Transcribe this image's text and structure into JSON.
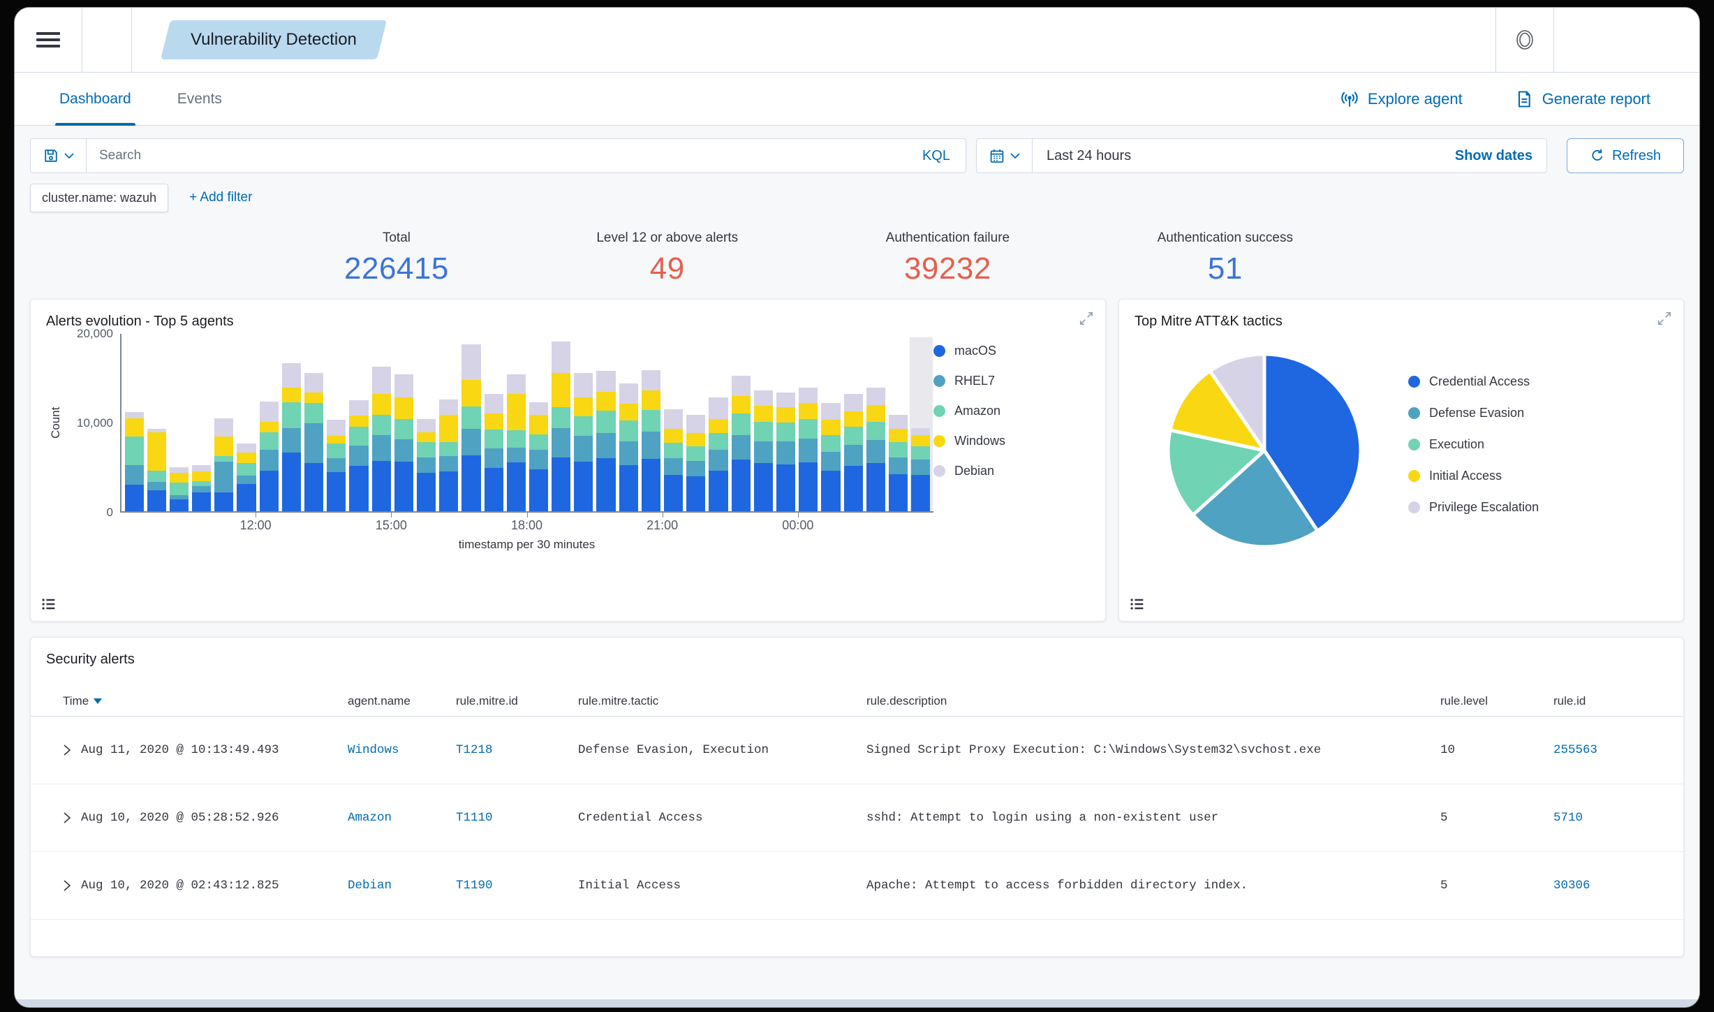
{
  "header": {
    "breadcrumb": "Vulnerability Detection"
  },
  "tabs": [
    {
      "label": "Dashboard",
      "active": true
    },
    {
      "label": "Events",
      "active": false
    }
  ],
  "actions": {
    "explore_agent": "Explore agent",
    "generate_report": "Generate report"
  },
  "search": {
    "placeholder": "Search",
    "language": "KQL"
  },
  "datepicker": {
    "value": "Last 24 hours",
    "show_dates": "Show dates",
    "refresh": "Refresh"
  },
  "filters": {
    "pills": [
      "cluster.name: wazuh"
    ],
    "add_filter": "+ Add filter"
  },
  "stats": [
    {
      "label": "Total",
      "value": "226415",
      "color": "#3b73d8"
    },
    {
      "label": "Level 12 or above alerts",
      "value": "49",
      "color": "#e4604e"
    },
    {
      "label": "Authentication failure",
      "value": "39232",
      "color": "#e4604e"
    },
    {
      "label": "Authentication success",
      "value": "51",
      "color": "#3b73d8"
    }
  ],
  "chart_data": [
    {
      "type": "bar",
      "stacked": true,
      "title": "Alerts evolution - Top 5 agents",
      "xlabel": "timestamp per 30 minutes",
      "ylabel": "Count",
      "ylim": [
        0,
        20000
      ],
      "yticks": [
        {
          "label": "0",
          "frac": 0
        },
        {
          "label": "10,000",
          "frac": 0.5
        },
        {
          "label": "20,000",
          "frac": 1
        }
      ],
      "xticks": [
        {
          "label": "12:00",
          "boundary": 6
        },
        {
          "label": "15:00",
          "boundary": 12
        },
        {
          "label": "18:00",
          "boundary": 18
        },
        {
          "label": "21:00",
          "boundary": 24
        },
        {
          "label": "00:00",
          "boundary": 30
        }
      ],
      "n_bars": 36,
      "series": [
        {
          "name": "macOS",
          "color": "#1f67e0"
        },
        {
          "name": "RHEL7",
          "color": "#4fa2c2"
        },
        {
          "name": "Amazon",
          "color": "#6fd3b4"
        },
        {
          "name": "Windows",
          "color": "#f9d713"
        },
        {
          "name": "Debian",
          "color": "#d6d3e6"
        }
      ],
      "bars": [
        [
          3000,
          2200,
          3200,
          2100,
          700
        ],
        [
          2400,
          900,
          1300,
          4300,
          400
        ],
        [
          1300,
          500,
          1400,
          1100,
          700
        ],
        [
          2100,
          700,
          600,
          1100,
          700
        ],
        [
          2100,
          3500,
          600,
          2200,
          2100
        ],
        [
          3100,
          900,
          1400,
          1200,
          1000
        ],
        [
          4600,
          2300,
          2000,
          1200,
          2300
        ],
        [
          6600,
          2800,
          2900,
          1600,
          2800
        ],
        [
          5400,
          4500,
          2300,
          1200,
          2200
        ],
        [
          4400,
          1600,
          1600,
          900,
          1800
        ],
        [
          5100,
          2300,
          2100,
          1300,
          1700
        ],
        [
          5700,
          2900,
          2300,
          2300,
          3100
        ],
        [
          5600,
          2500,
          2300,
          2400,
          2600
        ],
        [
          4300,
          1800,
          1700,
          1100,
          1500
        ],
        [
          4500,
          1700,
          1600,
          3100,
          1700
        ],
        [
          6300,
          3000,
          2500,
          3000,
          4000
        ],
        [
          4900,
          2200,
          2100,
          1800,
          2200
        ],
        [
          5500,
          1700,
          1900,
          4100,
          2200
        ],
        [
          4700,
          2200,
          1800,
          2200,
          1400
        ],
        [
          6100,
          3300,
          2300,
          3900,
          3500
        ],
        [
          5600,
          2900,
          2200,
          2100,
          2800
        ],
        [
          6000,
          2800,
          2500,
          2200,
          2300
        ],
        [
          5200,
          2700,
          2300,
          1900,
          2300
        ],
        [
          5900,
          3100,
          2400,
          2200,
          2300
        ],
        [
          4100,
          1900,
          1700,
          1600,
          2200
        ],
        [
          3900,
          1800,
          1600,
          1500,
          2100
        ],
        [
          4600,
          2300,
          1900,
          1600,
          2400
        ],
        [
          5800,
          2800,
          2400,
          2000,
          2300
        ],
        [
          5400,
          2500,
          2200,
          1800,
          1700
        ],
        [
          5300,
          2600,
          2100,
          1700,
          1700
        ],
        [
          5500,
          2700,
          2200,
          1800,
          1700
        ],
        [
          4600,
          2100,
          1900,
          1700,
          1900
        ],
        [
          5100,
          2400,
          2000,
          1800,
          1900
        ],
        [
          5400,
          2600,
          2100,
          1900,
          1900
        ],
        [
          4200,
          1900,
          1700,
          1500,
          1600
        ],
        [
          4100,
          1700,
          1500,
          1300,
          800
        ]
      ],
      "current_bucket_highlight": {
        "bar_index": 35,
        "color": "#e9e9ed"
      },
      "legend_position": "right"
    },
    {
      "type": "pie",
      "title": "Top Mitre ATT&K tactics",
      "labels": [
        "Credential Access",
        "Defense Evasion",
        "Execution",
        "Initial Access",
        "Privilege Escalation"
      ],
      "values": [
        40.5,
        22.5,
        15,
        12,
        9.5
      ],
      "unit": "percent-estimated",
      "colors": [
        "#1f67e0",
        "#4fa2c2",
        "#6fd3b4",
        "#f9d713",
        "#d6d3e6"
      ],
      "legend_position": "right"
    }
  ],
  "table": {
    "title": "Security alerts",
    "columns": [
      "Time",
      "agent.name",
      "rule.mitre.id",
      "rule.mitre.tactic",
      "rule.description",
      "rule.level",
      "rule.id"
    ],
    "sort": {
      "column": "Time",
      "direction": "desc"
    },
    "rows": [
      {
        "time": "Aug 11, 2020 @ 10:13:49.493",
        "agent": "Windows",
        "mitre_id": "T1218",
        "tactic": "Defense Evasion, Execution",
        "description": "Signed Script Proxy Execution: C:\\Windows\\System32\\svchost.exe",
        "level": "10",
        "rule_id": "255563"
      },
      {
        "time": "Aug 10, 2020 @ 05:28:52.926",
        "agent": "Amazon",
        "mitre_id": "T1110",
        "tactic": "Credential Access",
        "description": "sshd: Attempt to login using a non-existent user",
        "level": "5",
        "rule_id": "5710"
      },
      {
        "time": "Aug 10, 2020 @ 02:43:12.825",
        "agent": "Debian",
        "mitre_id": "T1190",
        "tactic": "Initial Access",
        "description": "Apache: Attempt to access forbidden directory index.",
        "level": "5",
        "rule_id": "30306"
      }
    ]
  }
}
